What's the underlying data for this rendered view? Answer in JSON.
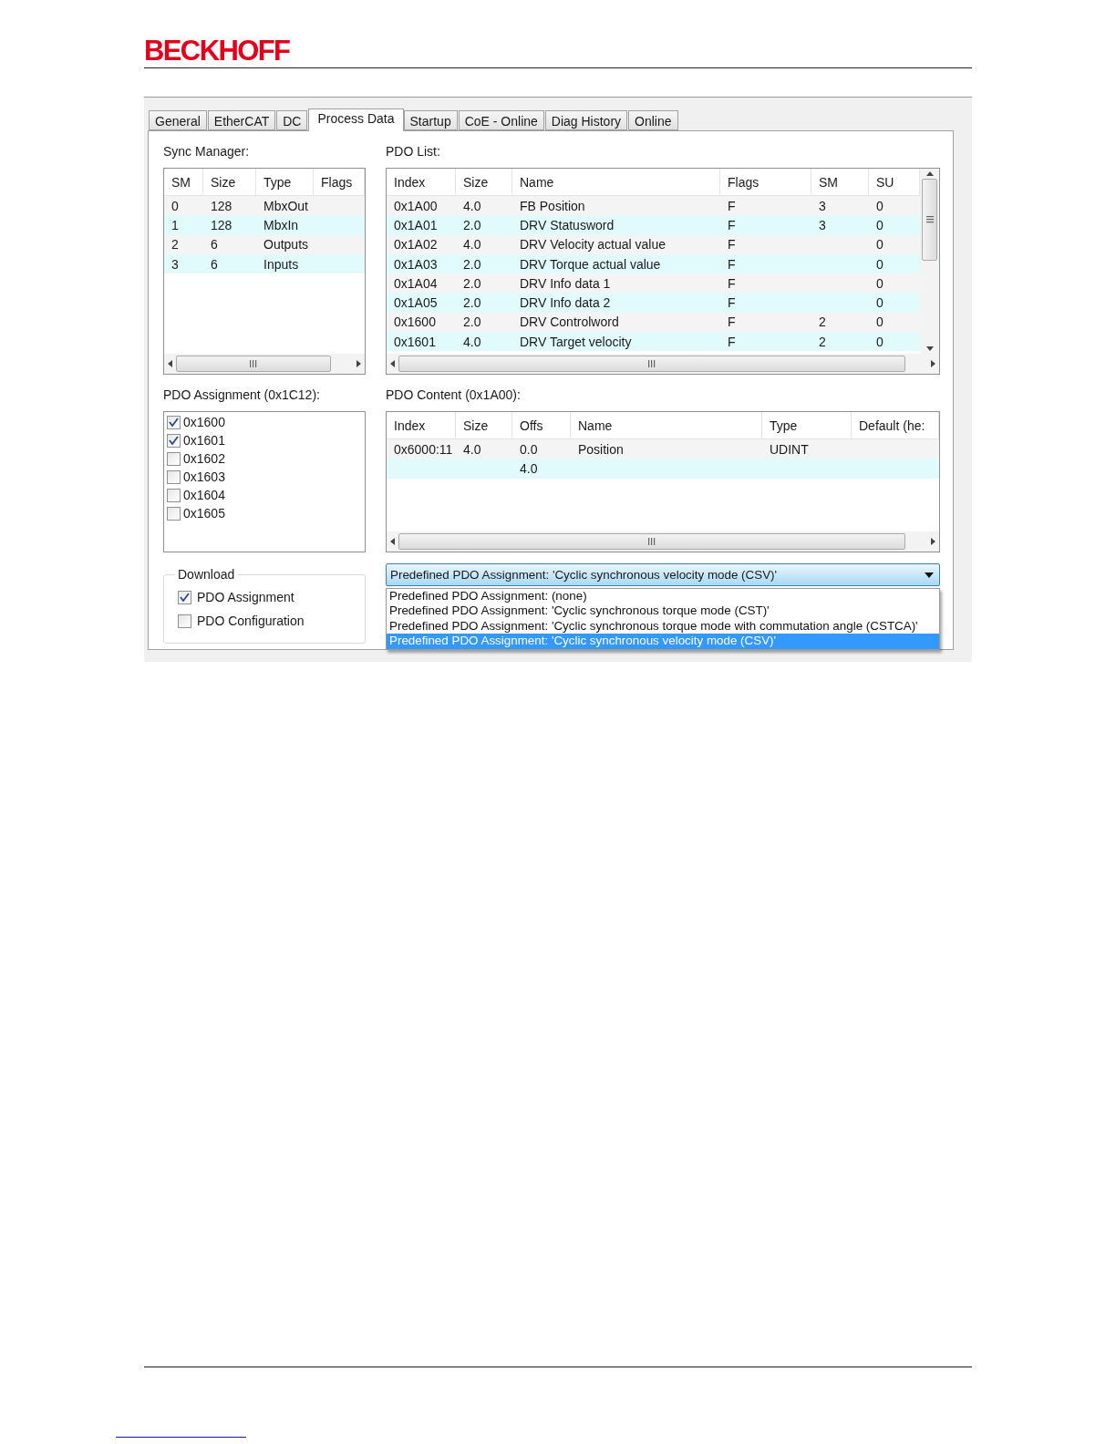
{
  "header": {
    "logo": "BECKHOFF"
  },
  "dialog": {
    "tabs": [
      {
        "label": "General",
        "selected": false
      },
      {
        "label": "EtherCAT",
        "selected": false
      },
      {
        "label": "DC",
        "selected": false
      },
      {
        "label": "Process Data",
        "selected": true
      },
      {
        "label": "Startup",
        "selected": false
      },
      {
        "label": "CoE - Online",
        "selected": false
      },
      {
        "label": "Diag History",
        "selected": false
      },
      {
        "label": "Online",
        "selected": false
      }
    ],
    "sync_manager": {
      "label": "Sync Manager:",
      "columns": [
        "SM",
        "Size",
        "Type",
        "Flags"
      ],
      "rows": [
        [
          "0",
          "128",
          "MbxOut",
          ""
        ],
        [
          "1",
          "128",
          "MbxIn",
          ""
        ],
        [
          "2",
          "6",
          "Outputs",
          ""
        ],
        [
          "3",
          "6",
          "Inputs",
          ""
        ]
      ]
    },
    "pdo_list": {
      "label": "PDO List:",
      "columns": [
        "Index",
        "Size",
        "Name",
        "Flags",
        "SM",
        "SU"
      ],
      "rows": [
        [
          "0x1A00",
          "4.0",
          "FB Position",
          "F",
          "3",
          "0"
        ],
        [
          "0x1A01",
          "2.0",
          "DRV Statusword",
          "F",
          "3",
          "0"
        ],
        [
          "0x1A02",
          "4.0",
          "DRV Velocity actual value",
          "F",
          "",
          "0"
        ],
        [
          "0x1A03",
          "2.0",
          "DRV Torque actual value",
          "F",
          "",
          "0"
        ],
        [
          "0x1A04",
          "2.0",
          "DRV Info data 1",
          "F",
          "",
          "0"
        ],
        [
          "0x1A05",
          "2.0",
          "DRV Info data 2",
          "F",
          "",
          "0"
        ],
        [
          "0x1600",
          "2.0",
          "DRV Controlword",
          "F",
          "2",
          "0"
        ],
        [
          "0x1601",
          "4.0",
          "DRV Target velocity",
          "F",
          "2",
          "0"
        ]
      ]
    },
    "pdo_assignment": {
      "label": "PDO Assignment (0x1C12):",
      "items": [
        {
          "label": "0x1600",
          "checked": true
        },
        {
          "label": "0x1601",
          "checked": true
        },
        {
          "label": "0x1602",
          "checked": false
        },
        {
          "label": "0x1603",
          "checked": false
        },
        {
          "label": "0x1604",
          "checked": false
        },
        {
          "label": "0x1605",
          "checked": false
        }
      ]
    },
    "pdo_content": {
      "label": "PDO Content (0x1A00):",
      "columns": [
        "Index",
        "Size",
        "Offs",
        "Name",
        "Type",
        "Default (he:"
      ],
      "rows": [
        [
          "0x6000:11",
          "4.0",
          "0.0",
          "Position",
          "UDINT",
          ""
        ],
        [
          "",
          "",
          "4.0",
          "",
          "",
          ""
        ]
      ]
    },
    "download": {
      "title": "Download",
      "options": [
        {
          "label": "PDO Assignment",
          "checked": true
        },
        {
          "label": "PDO Configuration",
          "checked": false
        }
      ]
    },
    "predefined": {
      "value": "Predefined PDO Assignment: 'Cyclic synchronous velocity mode (CSV)'",
      "options": [
        {
          "label": "Predefined PDO Assignment: (none)",
          "selected": false
        },
        {
          "label": "Predefined PDO Assignment: 'Cyclic synchronous torque mode (CST)'",
          "selected": false
        },
        {
          "label": "Predefined PDO Assignment: 'Cyclic synchronous torque mode with commutation angle (CSTCA)'",
          "selected": false
        },
        {
          "label": "Predefined PDO Assignment: 'Cyclic synchronous velocity mode (CSV)'",
          "selected": true
        }
      ]
    }
  }
}
